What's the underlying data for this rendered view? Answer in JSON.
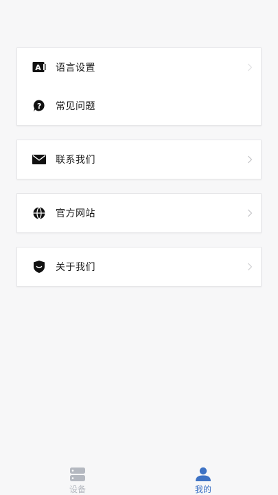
{
  "colors": {
    "background": "#f7f7f8",
    "card": "#ffffff",
    "accent": "#3d72c4",
    "inactive": "#b4b8c0",
    "text": "#1a1a1a",
    "chevron": "#c9c9cc"
  },
  "menu": {
    "group1": [
      {
        "label": "语言设置",
        "icon": "language-icon"
      },
      {
        "label": "常见问题",
        "icon": "question-icon"
      }
    ],
    "group2": [
      {
        "label": "联系我们",
        "icon": "mail-icon"
      }
    ],
    "group3": [
      {
        "label": "官方网站",
        "icon": "globe-icon"
      }
    ],
    "group4": [
      {
        "label": "关于我们",
        "icon": "shield-icon"
      }
    ]
  },
  "tabbar": {
    "items": [
      {
        "label": "设备",
        "icon": "server-icon",
        "active": false
      },
      {
        "label": "我的",
        "icon": "user-icon",
        "active": true
      }
    ]
  }
}
